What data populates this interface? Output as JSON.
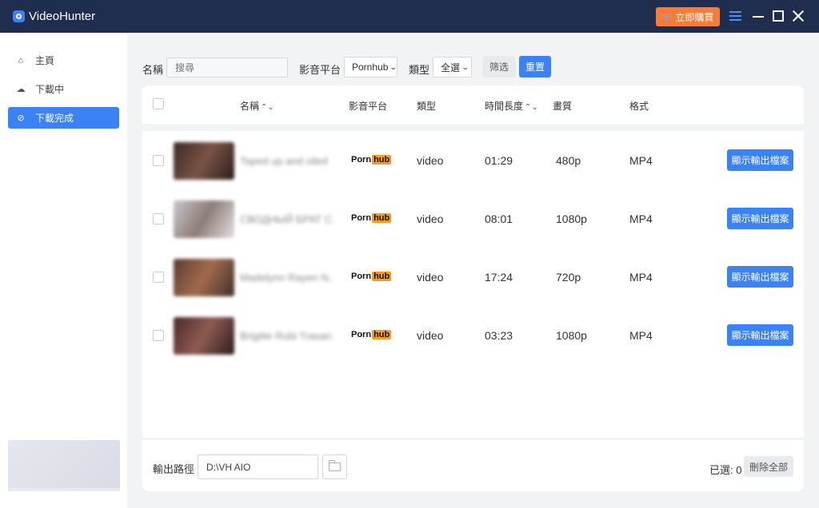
{
  "app": {
    "title": "VideoHunter",
    "buy_label": "立即購買"
  },
  "sidebar": {
    "items": [
      {
        "label": "主頁",
        "icon": "home-icon"
      },
      {
        "label": "下載中",
        "icon": "download-cloud-icon"
      },
      {
        "label": "下載完成",
        "icon": "check-circle-icon",
        "active": true
      }
    ]
  },
  "filters": {
    "name_label": "名稱",
    "search_placeholder": "搜尋",
    "platform_label": "影音平台",
    "platform_value": "Pornhub",
    "type_label": "類型",
    "type_value": "全選",
    "filter_button": "筛选",
    "reset_button": "重置"
  },
  "table": {
    "columns": {
      "name": "名稱",
      "platform": "影音平台",
      "type": "類型",
      "duration": "時間長度",
      "quality": "畫質",
      "format": "格式"
    },
    "rows": [
      {
        "title": "Taped up and oiled",
        "platform_a": "Porn",
        "platform_b": "hub",
        "type": "video",
        "duration": "01:29",
        "quality": "480p",
        "format": "MP4",
        "action": "顯示輸出檔案"
      },
      {
        "title": "СВОДНЫЙ БРАТ С...",
        "platform_a": "Porn",
        "platform_b": "hub",
        "type": "video",
        "duration": "08:01",
        "quality": "1080p",
        "format": "MP4",
        "action": "顯示輸出檔案"
      },
      {
        "title": "Madelynn Rayen N...",
        "platform_a": "Porn",
        "platform_b": "hub",
        "type": "video",
        "duration": "17:24",
        "quality": "720p",
        "format": "MP4",
        "action": "顯示輸出檔案"
      },
      {
        "title": "Brigitte Rubi Trasan...",
        "platform_a": "Porn",
        "platform_b": "hub",
        "type": "video",
        "duration": "03:23",
        "quality": "1080p",
        "format": "MP4",
        "action": "顯示輸出檔案"
      }
    ]
  },
  "footer": {
    "output_label": "輸出路徑",
    "output_path": "D:\\VH AIO",
    "selected_text": "已選: 0",
    "delete_all": "刪除全部"
  },
  "colors": {
    "titlebar": "#1f2d4e",
    "accent": "#3b82f6",
    "buy": "#f97b3a",
    "platform_badge": "#f79c1c"
  }
}
